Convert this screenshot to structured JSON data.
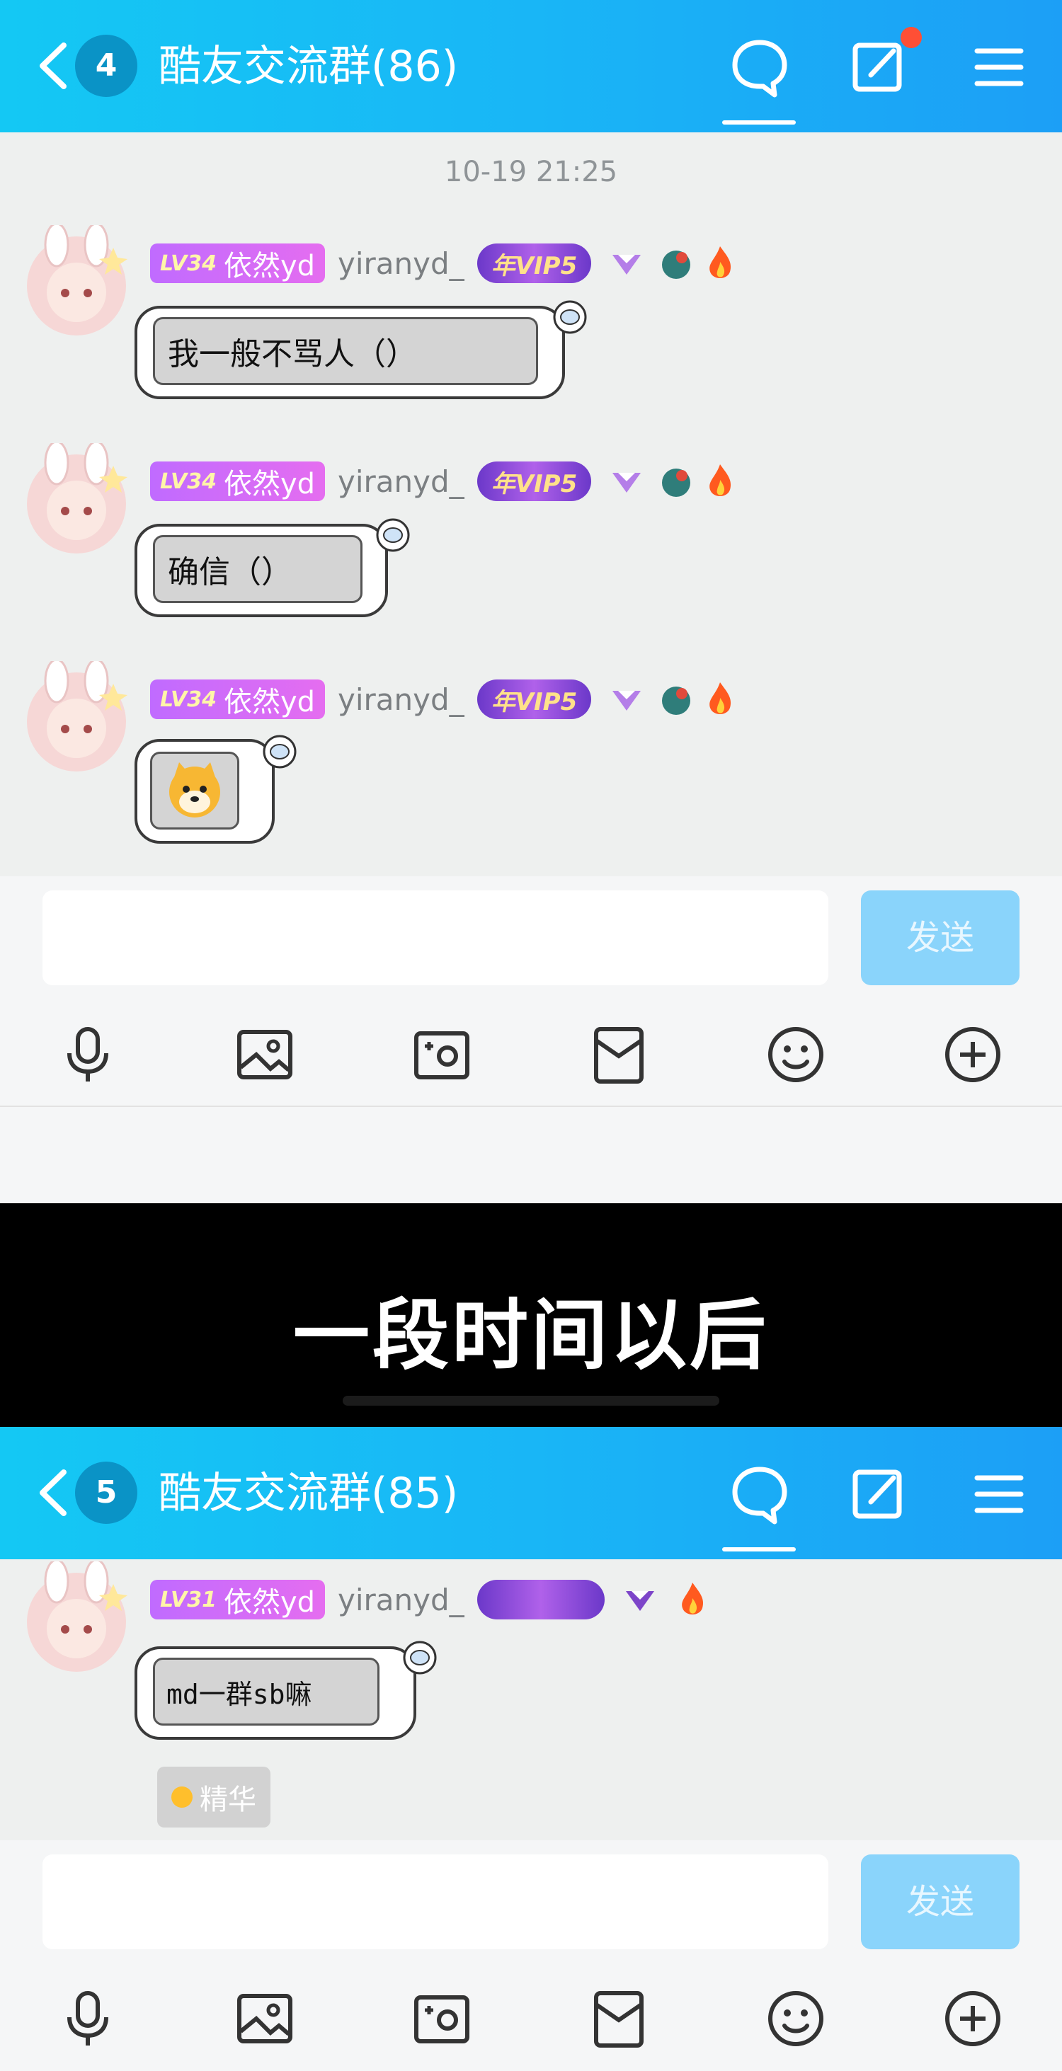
{
  "top_panel": {
    "header": {
      "badge_count": "4",
      "title": "酷友交流群(86)"
    },
    "timestamp": "10-19 21:25",
    "messages": [
      {
        "level": "LV34",
        "name": "依然yd",
        "username": "yiranyd_",
        "vip": "年VIP5",
        "text": "我一般不骂人（）"
      },
      {
        "level": "LV34",
        "name": "依然yd",
        "username": "yiranyd_",
        "vip": "年VIP5",
        "text": "确信（）"
      },
      {
        "level": "LV34",
        "name": "依然yd",
        "username": "yiranyd_",
        "vip": "年VIP5",
        "text": "",
        "sticker": "shiba-emoji"
      }
    ],
    "send_label": "发送"
  },
  "caption": "一段时间以后",
  "bottom_panel": {
    "header": {
      "badge_count": "5",
      "title": "酷友交流群(85)"
    },
    "messages": [
      {
        "level": "LV31",
        "name": "依然yd",
        "username": "yiranyd_",
        "text": "md一群sb嘛"
      }
    ],
    "essence_label": "精华",
    "send_label": "发送"
  },
  "icons": [
    "back-icon",
    "chat-icon",
    "edit-icon",
    "menu-icon",
    "microphone-icon",
    "image-icon",
    "camera-icon",
    "red-packet-icon",
    "emoji-icon",
    "plus-icon"
  ],
  "colors": {
    "header_start": "#14c8f4",
    "header_end": "#1c9ff6",
    "send_button": "#8ad4fb",
    "level_badge": "#c06bff",
    "vip_badge": "#7a3fd0"
  }
}
